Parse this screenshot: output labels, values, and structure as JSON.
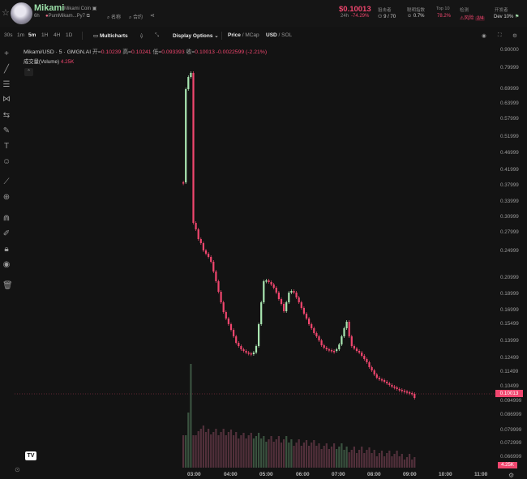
{
  "header": {
    "coin_name": "Mikami",
    "coin_full_name": "Mikami Coin",
    "age": "6h",
    "launchpad": "Pum",
    "address": "Mikam...Py7",
    "name_tag": "名称",
    "contract_tag": "合约",
    "price": "$0.10013",
    "change_label": "24h",
    "change_pct": "-74.29%",
    "stats": [
      {
        "label": "狙击者",
        "value": "9 / 70"
      },
      {
        "label": "聪明指数",
        "value": "0.7%"
      },
      {
        "label": "Top 10",
        "value": "78.2%"
      },
      {
        "label": "检测",
        "value": "风险",
        "extra": "2/4"
      },
      {
        "label": "开发者",
        "value": "Dev 10%"
      }
    ]
  },
  "toolbar": {
    "intervals": [
      "30s",
      "1m",
      "5m",
      "1H",
      "4H",
      "1D"
    ],
    "active_interval": "5m",
    "multicharts": "Multicharts",
    "display_options": "Display Options",
    "price_label": "Price",
    "mcap_label": "MCap",
    "usd_label": "USD",
    "sol_label": "SOL"
  },
  "legend": {
    "pair": "Mikami/USD · 5 · GMGN.AI",
    "open_label": "开=",
    "open": "0.10239",
    "high_label": "高=",
    "high": "0.10241",
    "low_label": "低=",
    "low": "0.093393",
    "close_label": "收=",
    "close": "0.10013",
    "change": "-0.0022599 (-2.21%)",
    "volume_label": "成交量(Volume)",
    "volume_value": "4.25K"
  },
  "price_tag": "0.10013",
  "volume_tag": "4.25K",
  "colors": {
    "up": "#a9e6b1",
    "down": "#f0466e",
    "bg": "#131313"
  },
  "icons": [
    "crosshair-icon",
    "trendline-icon",
    "fib-icon",
    "pattern-icon",
    "forecast-icon",
    "brush-icon",
    "text-icon",
    "emoji-icon",
    "ruler-icon",
    "zoom-icon",
    "magnet-icon",
    "lock-drawing-icon",
    "lock-icon",
    "eye-icon",
    "trash-icon",
    "camera-icon",
    "fullscreen-icon",
    "settings-icon"
  ],
  "chart_data": {
    "type": "candlestick",
    "y_ticks": [
      "0.90000",
      "0.79999",
      "0.69999",
      "0.63999",
      "0.57999",
      "0.51999",
      "0.46999",
      "0.41999",
      "0.37999",
      "0.33999",
      "0.30999",
      "0.27999",
      "0.24999",
      "0.20999",
      "0.18999",
      "0.16999",
      "0.15499",
      "0.13999",
      "0.12499",
      "0.11499",
      "0.10499",
      "0.094999",
      "0.086999",
      "0.079999",
      "0.072999",
      "0.066999"
    ],
    "x_ticks": [
      "03:00",
      "04:00",
      "05:00",
      "06:00",
      "07:00",
      "08:00",
      "09:00",
      "10:00",
      "11:00"
    ],
    "current_price": 0.10013
  }
}
